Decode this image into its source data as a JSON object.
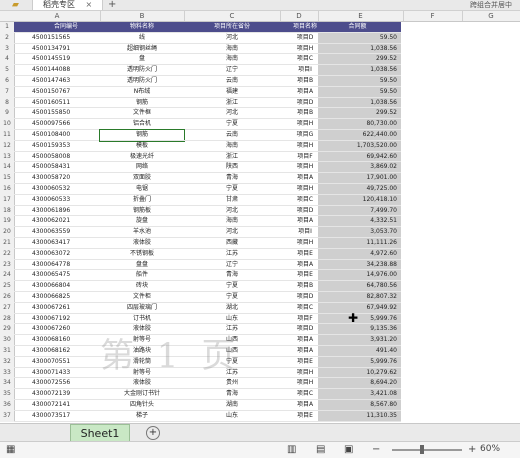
{
  "app": {
    "tab_label": "稻壳专区",
    "merge_center": "跨组合并居中",
    "sheet_tab": "Sheet1",
    "zoom": "60%",
    "watermark": "第 1 页"
  },
  "columns": [
    "A",
    "B",
    "C",
    "D",
    "E",
    "F",
    "G"
  ],
  "headers": [
    "合同编号",
    "物料名称",
    "项目所在省份",
    "项目名称",
    "合同额"
  ],
  "rows": [
    [
      "4500151565",
      "线",
      "河北",
      "项目D",
      "59.50"
    ],
    [
      "4500134791",
      "超细钢丝绳",
      "海南",
      "项目H",
      "1,038.56"
    ],
    [
      "4500145519",
      "盘",
      "海南",
      "项目C",
      "299.52"
    ],
    [
      "4500144088",
      "透明防火门",
      "辽宁",
      "项目I",
      "1,038.56"
    ],
    [
      "4500147463",
      "透明防火门",
      "云南",
      "项目B",
      "59.50"
    ],
    [
      "4500150767",
      "N布绒",
      "福建",
      "项目A",
      "59.50"
    ],
    [
      "4500160511",
      "钢筋",
      "浙江",
      "项目D",
      "1,038.56"
    ],
    [
      "4500155850",
      "文件框",
      "河北",
      "项目B",
      "299.52"
    ],
    [
      "4500097566",
      "铝合机",
      "宁夏",
      "项目H",
      "80,730.00"
    ],
    [
      "4500108400",
      "钢筋",
      "云南",
      "项目G",
      "622,440.00"
    ],
    [
      "4500159353",
      "模板",
      "海南",
      "项目H",
      "1,703,520.00"
    ],
    [
      "4500058008",
      "极速光纤",
      "浙江",
      "项目F",
      "69,942.60"
    ],
    [
      "4500058431",
      "网络",
      "陕西",
      "项目H",
      "3,869.02"
    ],
    [
      "4300058720",
      "双面胶",
      "青海",
      "项目A",
      "17,901.00"
    ],
    [
      "4300060532",
      "电锯",
      "宁夏",
      "项目H",
      "49,725.00"
    ],
    [
      "4300060533",
      "折叠门",
      "甘肃",
      "项目C",
      "120,418.10"
    ],
    [
      "4300061896",
      "钢筋板",
      "河北",
      "项目D",
      "7,499.70"
    ],
    [
      "4300062021",
      "旋盘",
      "海南",
      "项目A",
      "4,332.51"
    ],
    [
      "4300063559",
      "羊水池",
      "河北",
      "项目I",
      "3,053.70"
    ],
    [
      "4300063417",
      "液体胶",
      "西藏",
      "项目H",
      "11,111.26"
    ],
    [
      "4300063072",
      "不锈钢板",
      "江苏",
      "项目E",
      "4,972.60"
    ],
    [
      "4300064778",
      "盘盘",
      "辽宁",
      "项目A",
      "34,238.88"
    ],
    [
      "4300065475",
      "船件",
      "青海",
      "项目E",
      "14,976.00"
    ],
    [
      "4300066804",
      "砖块",
      "宁夏",
      "项目B",
      "64,780.56"
    ],
    [
      "4300066825",
      "文件柜",
      "宁夏",
      "项目D",
      "82,807.32"
    ],
    [
      "4300067261",
      "四层玻璃门",
      "湖北",
      "项目C",
      "67,949.92"
    ],
    [
      "4300067192",
      "订书机",
      "山东",
      "项目F",
      "5,999.76"
    ],
    [
      "4300067260",
      "液体胶",
      "江苏",
      "项目D",
      "9,135.36"
    ],
    [
      "4300068160",
      "射等号",
      "山西",
      "项目A",
      "3,931.20"
    ],
    [
      "4300068162",
      "油路块",
      "山西",
      "项目A",
      "491.40"
    ],
    [
      "4300070551",
      "滑轮筒",
      "宁夏",
      "项目E",
      "5,999.76"
    ],
    [
      "4300071433",
      "射等号",
      "江苏",
      "项目H",
      "10,279.62"
    ],
    [
      "4300072556",
      "液体胶",
      "贵州",
      "项目H",
      "8,694.20"
    ],
    [
      "4300072139",
      "大金刚订书针",
      "青海",
      "项目C",
      "3,421.08"
    ],
    [
      "4300072141",
      "四角针头",
      "湖南",
      "项目A",
      "8,567.80"
    ],
    [
      "4300073517",
      "梯子",
      "山东",
      "项目E",
      "11,310.35"
    ]
  ]
}
